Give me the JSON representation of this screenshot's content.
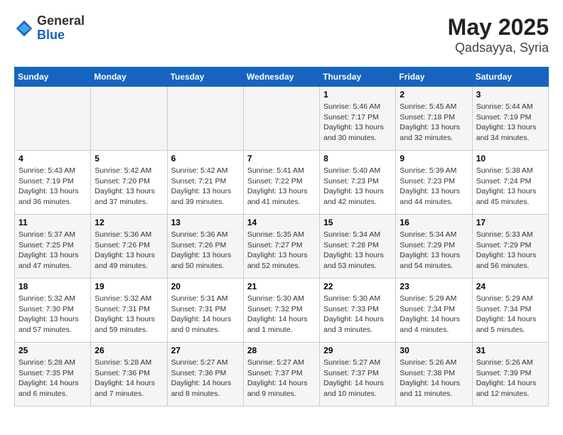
{
  "header": {
    "logo_general": "General",
    "logo_blue": "Blue",
    "title": "May 2025",
    "subtitle": "Qadsayya, Syria"
  },
  "days_of_week": [
    "Sunday",
    "Monday",
    "Tuesday",
    "Wednesday",
    "Thursday",
    "Friday",
    "Saturday"
  ],
  "weeks": [
    {
      "days": [
        {
          "num": "",
          "info": ""
        },
        {
          "num": "",
          "info": ""
        },
        {
          "num": "",
          "info": ""
        },
        {
          "num": "",
          "info": ""
        },
        {
          "num": "1",
          "info": "Sunrise: 5:46 AM\nSunset: 7:17 PM\nDaylight: 13 hours\nand 30 minutes."
        },
        {
          "num": "2",
          "info": "Sunrise: 5:45 AM\nSunset: 7:18 PM\nDaylight: 13 hours\nand 32 minutes."
        },
        {
          "num": "3",
          "info": "Sunrise: 5:44 AM\nSunset: 7:19 PM\nDaylight: 13 hours\nand 34 minutes."
        }
      ]
    },
    {
      "days": [
        {
          "num": "4",
          "info": "Sunrise: 5:43 AM\nSunset: 7:19 PM\nDaylight: 13 hours\nand 36 minutes."
        },
        {
          "num": "5",
          "info": "Sunrise: 5:42 AM\nSunset: 7:20 PM\nDaylight: 13 hours\nand 37 minutes."
        },
        {
          "num": "6",
          "info": "Sunrise: 5:42 AM\nSunset: 7:21 PM\nDaylight: 13 hours\nand 39 minutes."
        },
        {
          "num": "7",
          "info": "Sunrise: 5:41 AM\nSunset: 7:22 PM\nDaylight: 13 hours\nand 41 minutes."
        },
        {
          "num": "8",
          "info": "Sunrise: 5:40 AM\nSunset: 7:23 PM\nDaylight: 13 hours\nand 42 minutes."
        },
        {
          "num": "9",
          "info": "Sunrise: 5:39 AM\nSunset: 7:23 PM\nDaylight: 13 hours\nand 44 minutes."
        },
        {
          "num": "10",
          "info": "Sunrise: 5:38 AM\nSunset: 7:24 PM\nDaylight: 13 hours\nand 45 minutes."
        }
      ]
    },
    {
      "days": [
        {
          "num": "11",
          "info": "Sunrise: 5:37 AM\nSunset: 7:25 PM\nDaylight: 13 hours\nand 47 minutes."
        },
        {
          "num": "12",
          "info": "Sunrise: 5:36 AM\nSunset: 7:26 PM\nDaylight: 13 hours\nand 49 minutes."
        },
        {
          "num": "13",
          "info": "Sunrise: 5:36 AM\nSunset: 7:26 PM\nDaylight: 13 hours\nand 50 minutes."
        },
        {
          "num": "14",
          "info": "Sunrise: 5:35 AM\nSunset: 7:27 PM\nDaylight: 13 hours\nand 52 minutes."
        },
        {
          "num": "15",
          "info": "Sunrise: 5:34 AM\nSunset: 7:28 PM\nDaylight: 13 hours\nand 53 minutes."
        },
        {
          "num": "16",
          "info": "Sunrise: 5:34 AM\nSunset: 7:29 PM\nDaylight: 13 hours\nand 54 minutes."
        },
        {
          "num": "17",
          "info": "Sunrise: 5:33 AM\nSunset: 7:29 PM\nDaylight: 13 hours\nand 56 minutes."
        }
      ]
    },
    {
      "days": [
        {
          "num": "18",
          "info": "Sunrise: 5:32 AM\nSunset: 7:30 PM\nDaylight: 13 hours\nand 57 minutes."
        },
        {
          "num": "19",
          "info": "Sunrise: 5:32 AM\nSunset: 7:31 PM\nDaylight: 13 hours\nand 59 minutes."
        },
        {
          "num": "20",
          "info": "Sunrise: 5:31 AM\nSunset: 7:31 PM\nDaylight: 14 hours\nand 0 minutes."
        },
        {
          "num": "21",
          "info": "Sunrise: 5:30 AM\nSunset: 7:32 PM\nDaylight: 14 hours\nand 1 minute."
        },
        {
          "num": "22",
          "info": "Sunrise: 5:30 AM\nSunset: 7:33 PM\nDaylight: 14 hours\nand 3 minutes."
        },
        {
          "num": "23",
          "info": "Sunrise: 5:29 AM\nSunset: 7:34 PM\nDaylight: 14 hours\nand 4 minutes."
        },
        {
          "num": "24",
          "info": "Sunrise: 5:29 AM\nSunset: 7:34 PM\nDaylight: 14 hours\nand 5 minutes."
        }
      ]
    },
    {
      "days": [
        {
          "num": "25",
          "info": "Sunrise: 5:28 AM\nSunset: 7:35 PM\nDaylight: 14 hours\nand 6 minutes."
        },
        {
          "num": "26",
          "info": "Sunrise: 5:28 AM\nSunset: 7:36 PM\nDaylight: 14 hours\nand 7 minutes."
        },
        {
          "num": "27",
          "info": "Sunrise: 5:27 AM\nSunset: 7:36 PM\nDaylight: 14 hours\nand 8 minutes."
        },
        {
          "num": "28",
          "info": "Sunrise: 5:27 AM\nSunset: 7:37 PM\nDaylight: 14 hours\nand 9 minutes."
        },
        {
          "num": "29",
          "info": "Sunrise: 5:27 AM\nSunset: 7:37 PM\nDaylight: 14 hours\nand 10 minutes."
        },
        {
          "num": "30",
          "info": "Sunrise: 5:26 AM\nSunset: 7:38 PM\nDaylight: 14 hours\nand 11 minutes."
        },
        {
          "num": "31",
          "info": "Sunrise: 5:26 AM\nSunset: 7:39 PM\nDaylight: 14 hours\nand 12 minutes."
        }
      ]
    }
  ]
}
